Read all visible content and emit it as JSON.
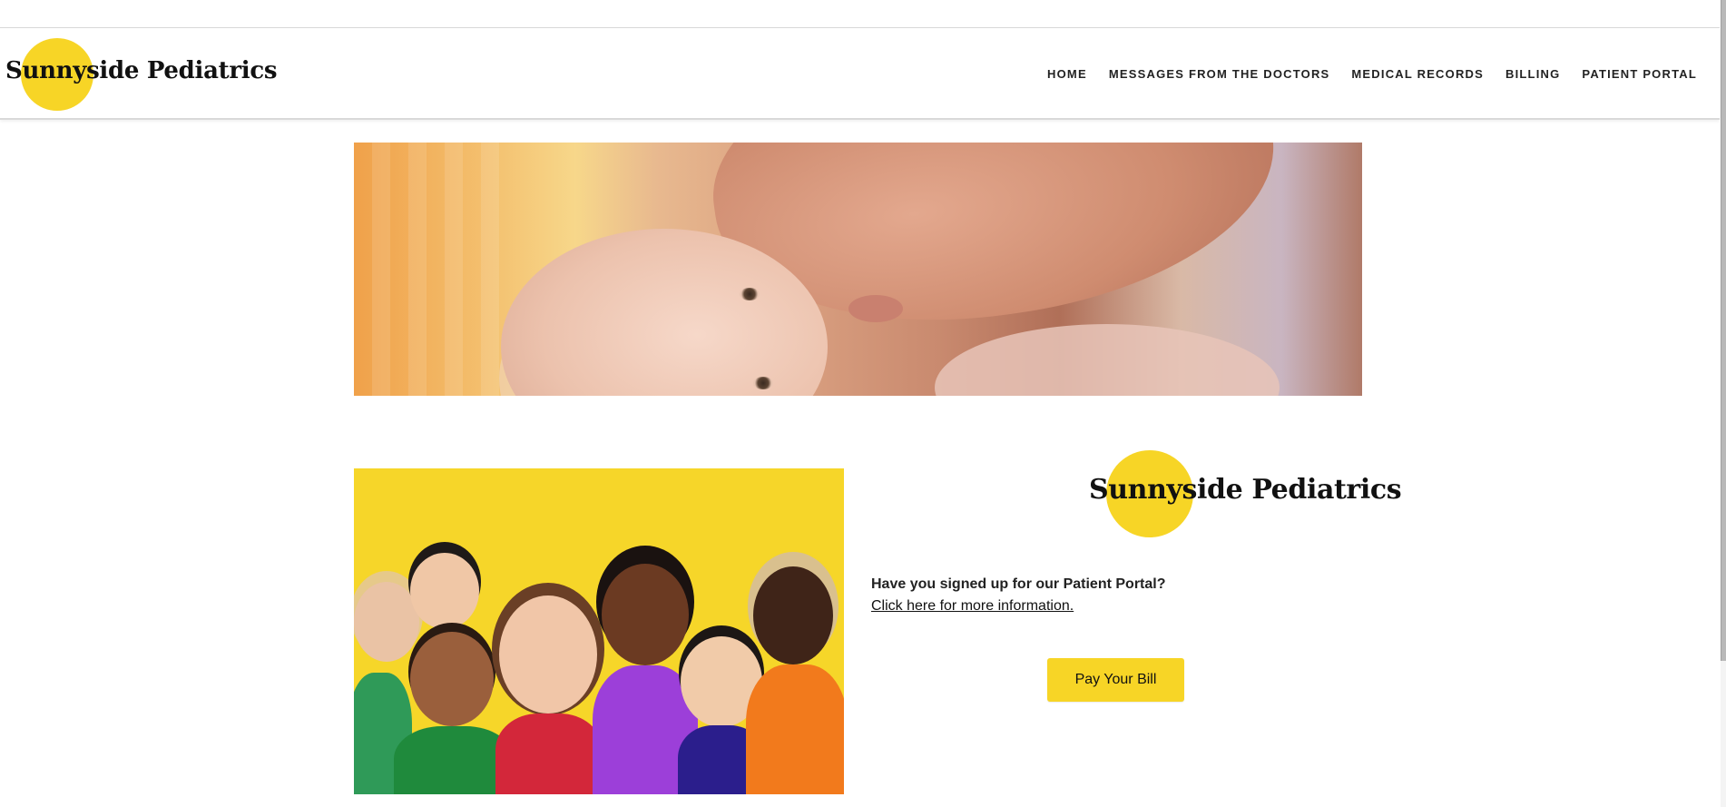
{
  "header": {
    "logo_text": "Sunnyside Pediatrics",
    "nav": [
      {
        "label": "HOME"
      },
      {
        "label": "MESSAGES FROM THE DOCTORS"
      },
      {
        "label": "MEDICAL RECORDS"
      },
      {
        "label": "BILLING"
      },
      {
        "label": "PATIENT PORTAL"
      }
    ]
  },
  "main": {
    "logo_text": "Sunnyside Pediatrics",
    "portal_question": "Have you signed up for our Patient Portal?",
    "portal_link": "Click here for more information.",
    "pay_button": "Pay Your Bill"
  },
  "colors": {
    "brand_yellow": "#f7d526",
    "text_dark": "#222222"
  },
  "images": {
    "hero": "mother-kissing-baby-photo",
    "kids": "group-of-smiling-children-photo"
  }
}
